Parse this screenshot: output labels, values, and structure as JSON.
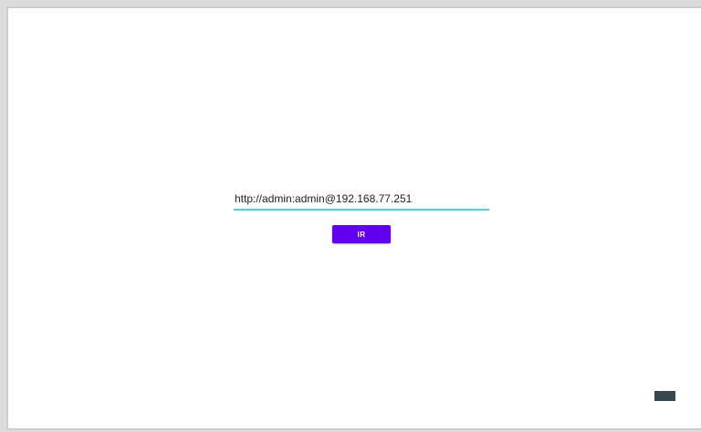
{
  "url_input": {
    "value": "http://admin:admin@192.168.77.251",
    "accent_color": "#3ed4d4"
  },
  "go_button": {
    "label": "IR",
    "color": "#6200ee"
  },
  "icons": {
    "bottom_right": "keyboard-icon"
  }
}
